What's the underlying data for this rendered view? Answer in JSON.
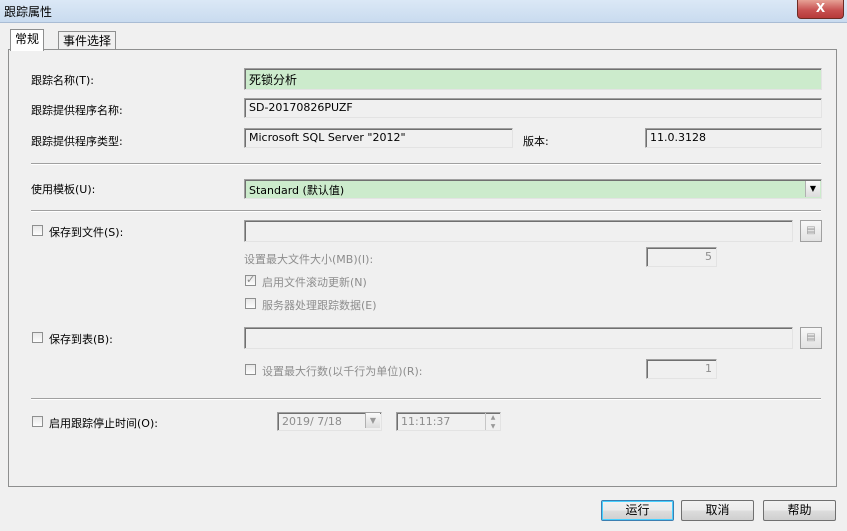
{
  "window": {
    "title": "跟踪属性",
    "close_label": "X"
  },
  "tabs": [
    {
      "label": "常规"
    },
    {
      "label": "事件选择"
    }
  ],
  "general": {
    "trace_name_label": "跟踪名称(T):",
    "trace_name_value": "死锁分析",
    "provider_name_label": "跟踪提供程序名称:",
    "provider_name_value": "SD-20170826PUZF",
    "provider_type_label": "跟踪提供程序类型:",
    "provider_type_value": "Microsoft SQL Server \"2012\"",
    "version_label": "版本:",
    "version_value": "11.0.3128",
    "template_label": "使用模板(U):",
    "template_value": "Standard (默认值)",
    "save_to_file_label": "保存到文件(S):",
    "save_to_file_value": "",
    "max_file_size_label": "设置最大文件大小(MB)(I):",
    "max_file_size_value": "5",
    "file_rollover_label": "启用文件滚动更新(N)",
    "server_processes_label": "服务器处理跟踪数据(E)",
    "save_to_table_label": "保存到表(B):",
    "save_to_table_value": "",
    "max_rows_label": "设置最大行数(以千行为单位)(R):",
    "max_rows_value": "1",
    "stop_time_label": "启用跟踪停止时间(O):",
    "stop_date_value": "2019/ 7/18",
    "stop_time_value": "11:11:37"
  },
  "buttons": {
    "run": "运行",
    "cancel": "取消",
    "help": "帮助"
  }
}
